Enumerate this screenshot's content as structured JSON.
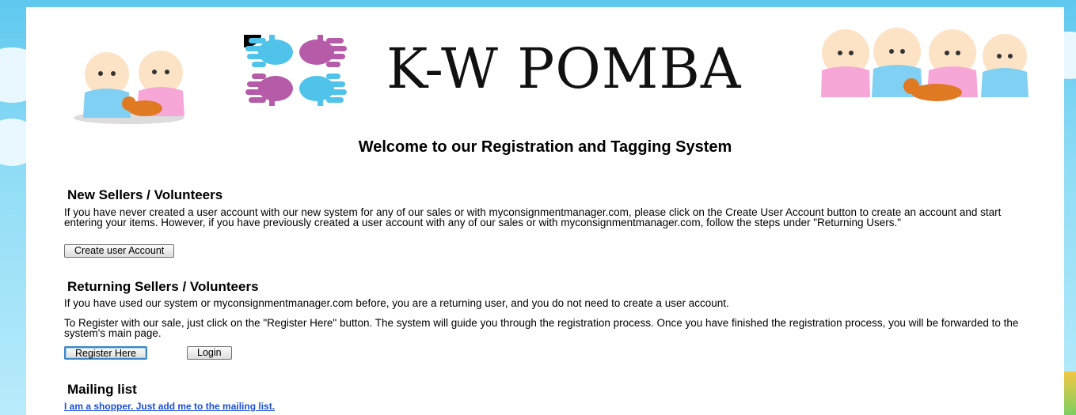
{
  "header": {
    "title": "K-W POMBA",
    "colors": {
      "hand_blue": "#4fc3ea",
      "hand_pink": "#b65ba8"
    }
  },
  "main": {
    "welcome": "Welcome to our Registration and Tagging System",
    "new_sellers": {
      "heading": "New Sellers / Volunteers",
      "text": "If you have never created a user account with our new system for any of our sales or with myconsignmentmanager.com, please click on the Create User Account button to create an account and start entering your items. However, if you have previously created a user account with any of our sales or with myconsignmentmanager.com, follow the steps under \"Returning Users.\"",
      "button": "Create user Account"
    },
    "returning": {
      "heading": "Returning Sellers / Volunteers",
      "text1": "If you have used our system or myconsignmentmanager.com before, you are a returning user, and you do not need to create a user account.",
      "text2": "To Register with our sale, just click on the \"Register Here\" button. The system will guide you through the registration process. Once you have finished the registration process, you will be forwarded to the system's main page.",
      "register_button": "Register Here",
      "login_button": "Login"
    },
    "mailing": {
      "heading": "Mailing list",
      "link": "I am a shopper. Just add me to the mailing list."
    }
  }
}
